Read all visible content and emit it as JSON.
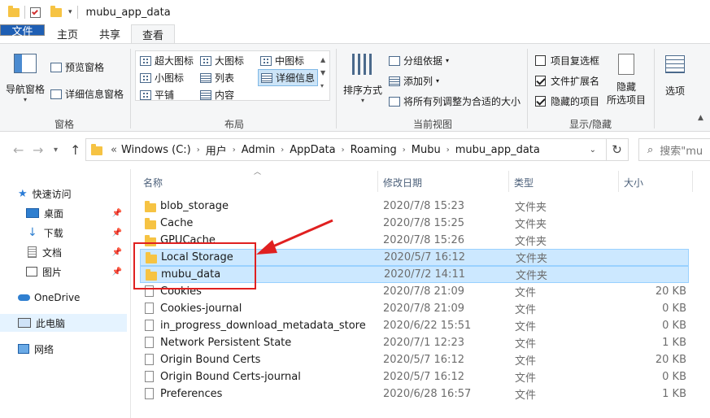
{
  "window": {
    "title": "mubu_app_data"
  },
  "tabs": [
    "文件",
    "主页",
    "共享",
    "查看"
  ],
  "ribbon": {
    "panes": {
      "nav_pane": "导航窗格",
      "preview": "预览窗格",
      "details": "详细信息窗格",
      "group": "窗格"
    },
    "layout": {
      "items": [
        "超大图标",
        "大图标",
        "中图标",
        "小图标",
        "列表",
        "详细信息",
        "平铺",
        "内容"
      ],
      "selected": "详细信息",
      "group": "布局"
    },
    "current_view": {
      "sort": "排序方式",
      "group_by": "分组依据",
      "add_column": "添加列",
      "fit_columns": "将所有列调整为合适的大小",
      "group": "当前视图"
    },
    "show_hide": {
      "item_checkboxes": {
        "label": "项目复选框",
        "checked": false
      },
      "file_extensions": {
        "label": "文件扩展名",
        "checked": true
      },
      "hidden_items": {
        "label": "隐藏的项目",
        "checked": true
      },
      "hide_selected": "隐藏\n所选项目",
      "options": "选项",
      "group": "显示/隐藏"
    }
  },
  "address": {
    "prefix": "«",
    "crumbs": [
      "Windows (C:)",
      "用户",
      "Admin",
      "AppData",
      "Roaming",
      "Mubu",
      "mubu_app_data"
    ]
  },
  "search": {
    "placeholder": "搜索\"mu"
  },
  "nav": {
    "quick_access": "快速访问",
    "items": [
      {
        "label": "桌面",
        "pinned": true
      },
      {
        "label": "下载",
        "pinned": true
      },
      {
        "label": "文档",
        "pinned": true
      },
      {
        "label": "图片",
        "pinned": true
      }
    ],
    "onedrive": "OneDrive",
    "this_pc": "此电脑",
    "network": "网络"
  },
  "columns": {
    "name": "名称",
    "date": "修改日期",
    "type": "类型",
    "size": "大小"
  },
  "files": [
    {
      "name": "blob_storage",
      "date": "2020/7/8 15:23",
      "type": "文件夹",
      "size": "",
      "kind": "folder"
    },
    {
      "name": "Cache",
      "date": "2020/7/8 15:25",
      "type": "文件夹",
      "size": "",
      "kind": "folder"
    },
    {
      "name": "GPUCache",
      "date": "2020/7/8 15:26",
      "type": "文件夹",
      "size": "",
      "kind": "folder"
    },
    {
      "name": "Local Storage",
      "date": "2020/5/7 16:12",
      "type": "文件夹",
      "size": "",
      "kind": "folder",
      "selected": true
    },
    {
      "name": "mubu_data",
      "date": "2020/7/2 14:11",
      "type": "文件夹",
      "size": "",
      "kind": "folder",
      "selected": true
    },
    {
      "name": "Cookies",
      "date": "2020/7/8 21:09",
      "type": "文件",
      "size": "20 KB",
      "kind": "file"
    },
    {
      "name": "Cookies-journal",
      "date": "2020/7/8 21:09",
      "type": "文件",
      "size": "0 KB",
      "kind": "file"
    },
    {
      "name": "in_progress_download_metadata_store",
      "date": "2020/6/22 15:51",
      "type": "文件",
      "size": "0 KB",
      "kind": "file"
    },
    {
      "name": "Network Persistent State",
      "date": "2020/7/1 12:23",
      "type": "文件",
      "size": "1 KB",
      "kind": "file"
    },
    {
      "name": "Origin Bound Certs",
      "date": "2020/5/7 16:12",
      "type": "文件",
      "size": "20 KB",
      "kind": "file"
    },
    {
      "name": "Origin Bound Certs-journal",
      "date": "2020/5/7 16:12",
      "type": "文件",
      "size": "0 KB",
      "kind": "file"
    },
    {
      "name": "Preferences",
      "date": "2020/6/28 16:57",
      "type": "文件",
      "size": "1 KB",
      "kind": "file"
    }
  ],
  "colors": {
    "accent": "#1f5fb4",
    "selection": "#cce8ff",
    "annotation": "#e02020",
    "folder": "#f6c343"
  }
}
